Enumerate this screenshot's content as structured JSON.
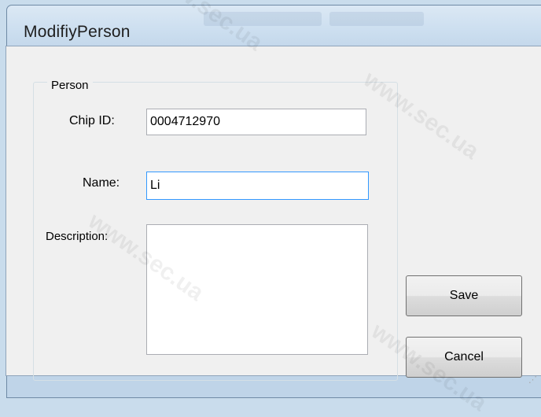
{
  "window": {
    "title": "ModifiyPerson"
  },
  "group": {
    "legend": "Person"
  },
  "fields": {
    "chip_id": {
      "label": "Chip ID:",
      "value": "0004712970"
    },
    "name": {
      "label": "Name:",
      "value": "Li"
    },
    "description": {
      "label": "Description:",
      "value": ""
    }
  },
  "buttons": {
    "save": "Save",
    "cancel": "Cancel"
  },
  "watermark": "www.sec.ua",
  "colors": {
    "focus_border": "#3399ff",
    "button_border": "#707070",
    "dialog_bg": "#f0f0f0"
  }
}
